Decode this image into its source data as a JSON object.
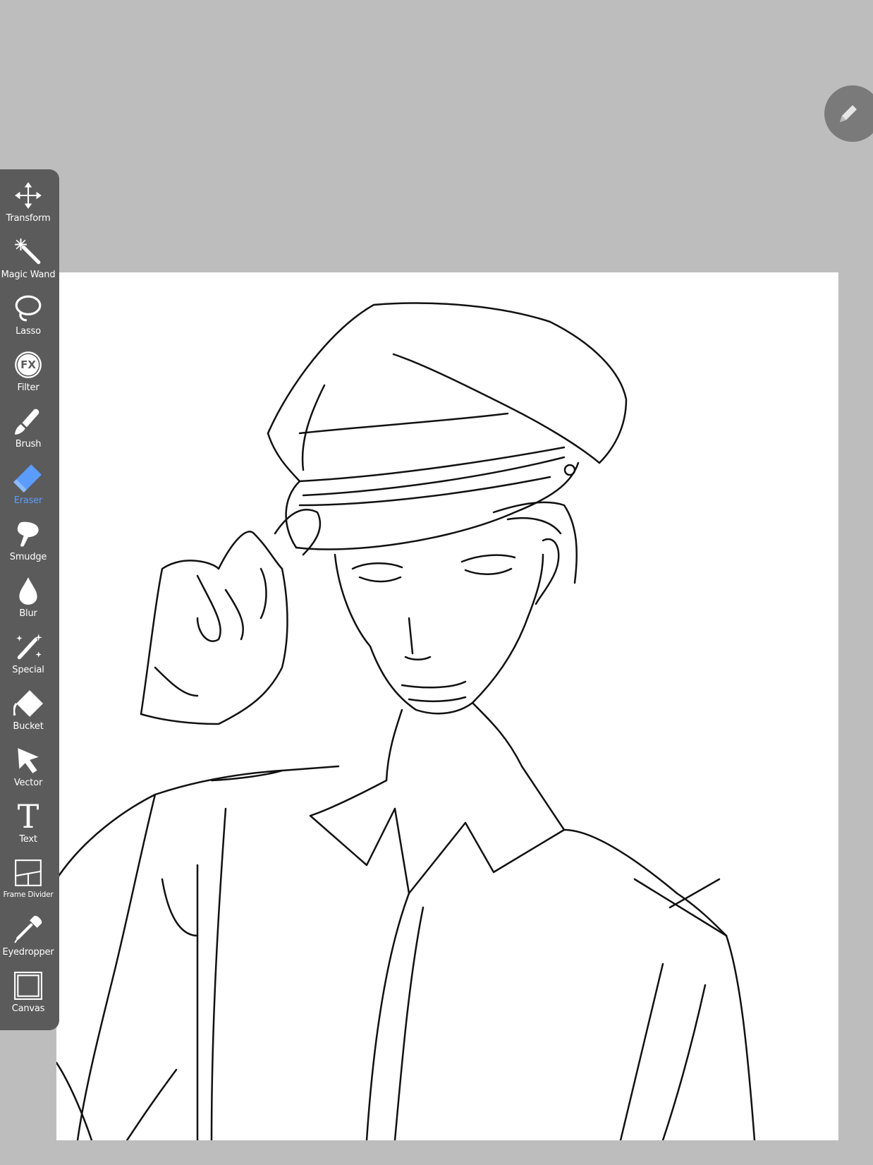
{
  "app": {
    "background_color": "#bdbdbd",
    "accent_color": "#5a9cff"
  },
  "toolbar": {
    "items": [
      {
        "label": "Transform",
        "icon": "move-arrows-icon"
      },
      {
        "label": "Magic Wand",
        "icon": "magic-wand-icon"
      },
      {
        "label": "Lasso",
        "icon": "lasso-icon"
      },
      {
        "label": "Filter",
        "icon": "fx-icon"
      },
      {
        "label": "Brush",
        "icon": "brush-icon"
      },
      {
        "label": "Eraser",
        "icon": "eraser-icon",
        "active": true
      },
      {
        "label": "Smudge",
        "icon": "smudge-icon"
      },
      {
        "label": "Blur",
        "icon": "droplet-icon"
      },
      {
        "label": "Special",
        "icon": "sparkle-pen-icon"
      },
      {
        "label": "Bucket",
        "icon": "bucket-icon"
      },
      {
        "label": "Vector",
        "icon": "cursor-arrow-icon"
      },
      {
        "label": "Text",
        "icon": "text-t-icon"
      },
      {
        "label": "Frame Divider",
        "icon": "frame-divider-icon"
      },
      {
        "label": "Eyedropper",
        "icon": "eyedropper-icon"
      },
      {
        "label": "Canvas",
        "icon": "canvas-square-icon"
      }
    ],
    "filter_glyph": "FX",
    "text_glyph": "T"
  },
  "floating_button": {
    "icon": "pencil-icon"
  }
}
